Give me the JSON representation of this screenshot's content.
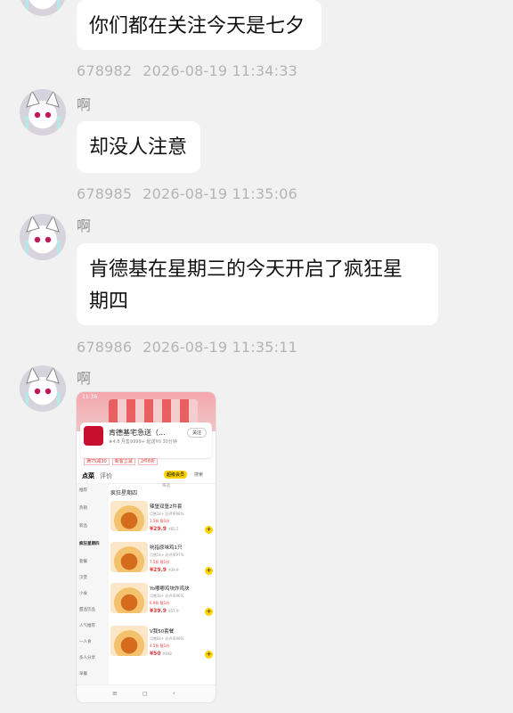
{
  "messages": [
    {
      "text": "你们都在关注今天是七夕",
      "id": "678982",
      "time": "2026-08-19 11:34:33"
    },
    {
      "sender": "啊",
      "text": "却没人注意",
      "id": "678985",
      "time": "2026-08-19 11:35:06"
    },
    {
      "sender": "啊",
      "text_line1": "肯德基在星期三的今天开启了疯狂星",
      "text_line2": "期四",
      "id": "678986",
      "time": "2026-08-19 11:35:11"
    },
    {
      "sender": "啊"
    }
  ],
  "shot": {
    "status_time": "11:36",
    "store_name": "肯德基宅急送（...",
    "store_sub": "★4.8 月售9999+ 起送¥0 30分钟",
    "follow": "关注",
    "promos": [
      "满75减30",
      "新客立减",
      "2件8折"
    ],
    "tabs": [
      "点菜",
      "评价"
    ],
    "member_pill": "超级会员",
    "search": "搜索",
    "section_title": "疯狂星期四",
    "filter": "筛选",
    "side_items": [
      "推荐",
      "热销",
      "新品",
      "疯狂星期四",
      "套餐",
      "汉堡",
      "小食",
      "甜品饮品",
      "人气推荐",
      "一人食",
      "多人分享",
      "早餐"
    ],
    "items": [
      {
        "name": "辣堡双堡2件套",
        "desc": "月售1k+ 好评率98%",
        "tag": "1.5折 限1份",
        "price": "¥29.9",
        "old": "¥65.5"
      },
      {
        "name": "吮指原味鸡1只",
        "desc": "月售5k+ 好评率97%",
        "tag": "7.5折 限1份",
        "price": "¥29.9",
        "old": "¥39.9"
      },
      {
        "name": "Yo嘟嘟鸡块炸鸡块",
        "desc": "月售3k+ 好评率96%",
        "tag": "6.9折 限1份",
        "price": "¥39.9",
        "old": "¥57.9"
      },
      {
        "name": "V我50套餐",
        "desc": "月售8k+ 好评率99%",
        "tag": "4.5折 限1份",
        "price": "¥50",
        "old": "¥108"
      }
    ],
    "nav": [
      "≡",
      "◻",
      "‹"
    ]
  }
}
